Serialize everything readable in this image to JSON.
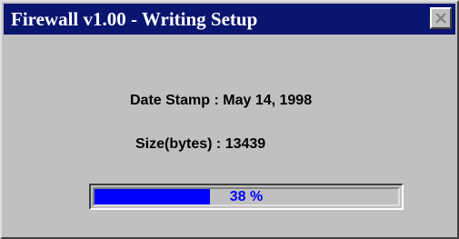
{
  "window": {
    "title": "Firewall v1.00 - Writing Setup"
  },
  "info": {
    "date_label": "Date Stamp :",
    "date_value": "May 14, 1998",
    "size_label": "Size(bytes) :",
    "size_value": "13439"
  },
  "progress": {
    "fraction": 0.38,
    "text": "38 %"
  },
  "colors": {
    "titlebar": "#0a1570",
    "progress_fill": "#0000ff",
    "progress_text": "#0000ff",
    "face": "#c0c0c0"
  },
  "icons": {
    "close": "close-icon"
  }
}
